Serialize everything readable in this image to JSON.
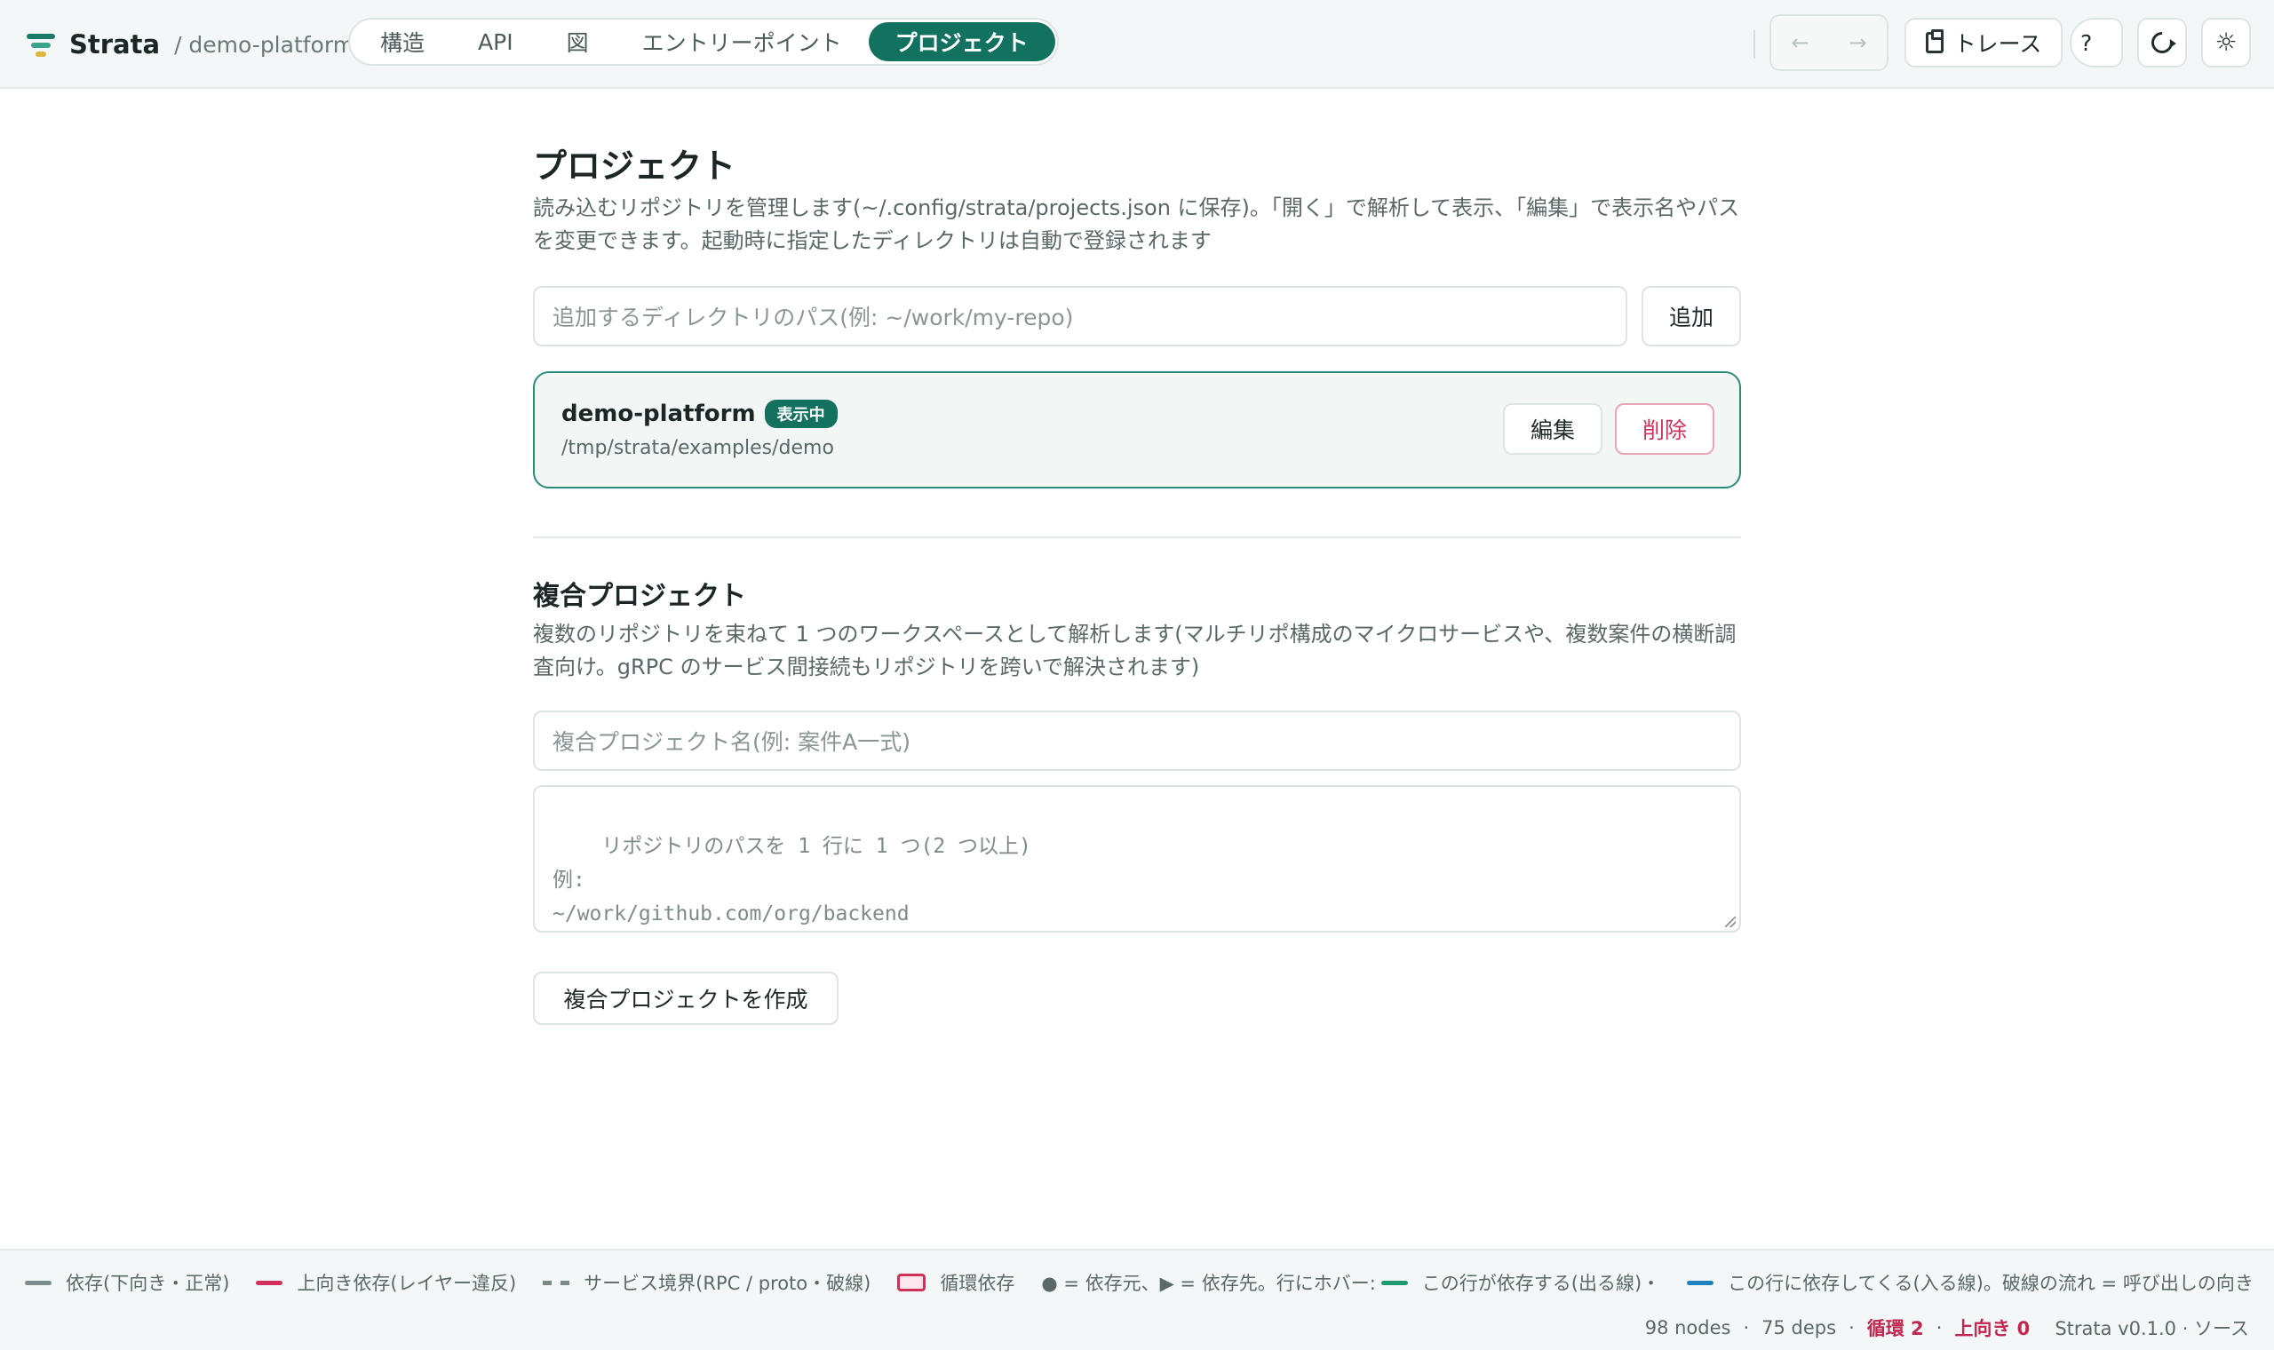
{
  "header": {
    "app_name": "Strata",
    "breadcrumb": "/ demo-platform",
    "tabs": [
      {
        "label": "構造"
      },
      {
        "label": "API"
      },
      {
        "label": "図"
      },
      {
        "label": "エントリーポイント"
      },
      {
        "label": "プロジェクト",
        "active": true
      }
    ],
    "nav": {
      "back": "←",
      "forward": "→"
    },
    "trace_label": "トレース",
    "help_label": "?",
    "icons": {
      "trace": "clipboard-icon",
      "refresh": "refresh-icon",
      "theme": "sun-icon"
    }
  },
  "projects": {
    "title": "プロジェクト",
    "description": "読み込むリポジトリを管理します(~/.config/strata/projects.json に保存)。「開く」で解析して表示、「編集」で表示名やパスを変更できます。起動時に指定したディレクトリは自動で登録されます",
    "add_placeholder": "追加するディレクトリのパス(例: ~/work/my-repo)",
    "add_label": "追加",
    "items": [
      {
        "name": "demo-platform",
        "badge": "表示中",
        "path": "/tmp/strata/examples/demo",
        "edit_label": "編集",
        "delete_label": "削除"
      }
    ]
  },
  "composite": {
    "title": "複合プロジェクト",
    "description": "複数のリポジトリを束ねて 1 つのワークスペースとして解析します(マルチリポ構成のマイクロサービスや、複数案件の横断調査向け。gRPC のサービス間接続もリポジトリを跨いで解決されます)",
    "name_placeholder": "複合プロジェクト名(例: 案件A一式)",
    "paths_placeholder": "リポジトリのパスを 1 行に 1 つ(2 つ以上)\n例:\n~/work/github.com/org/backend\n~/work/github.com/org/frontend",
    "create_label": "複合プロジェクトを作成"
  },
  "footer": {
    "legend": [
      {
        "type": "line",
        "color": "#7a8c8c",
        "label": "依存(下向き・正常)"
      },
      {
        "type": "line",
        "color": "#d0305a",
        "label": "上向き依存(レイヤー違反)"
      },
      {
        "type": "dash",
        "color": "#7a8888",
        "label": "サービス境界(RPC / proto・破線)"
      },
      {
        "type": "box",
        "color": "#d0305a",
        "label": "循環依存"
      },
      {
        "type": "text",
        "label": "● = 依存元、▶ = 依存先。行にホバー:"
      },
      {
        "type": "line",
        "color": "#1f9a70",
        "label": "この行が依存する(出る線)・"
      },
      {
        "type": "line",
        "color": "#1f82c0",
        "label": "この行に依存してくる(入る線)。破線の流れ = 呼び出しの向き"
      }
    ],
    "stats": {
      "nodes": "98 nodes",
      "deps": "75 deps",
      "cycles": "循環 2",
      "upward": "上向き 0",
      "version": "Strata v0.1.0 · ソース"
    }
  }
}
